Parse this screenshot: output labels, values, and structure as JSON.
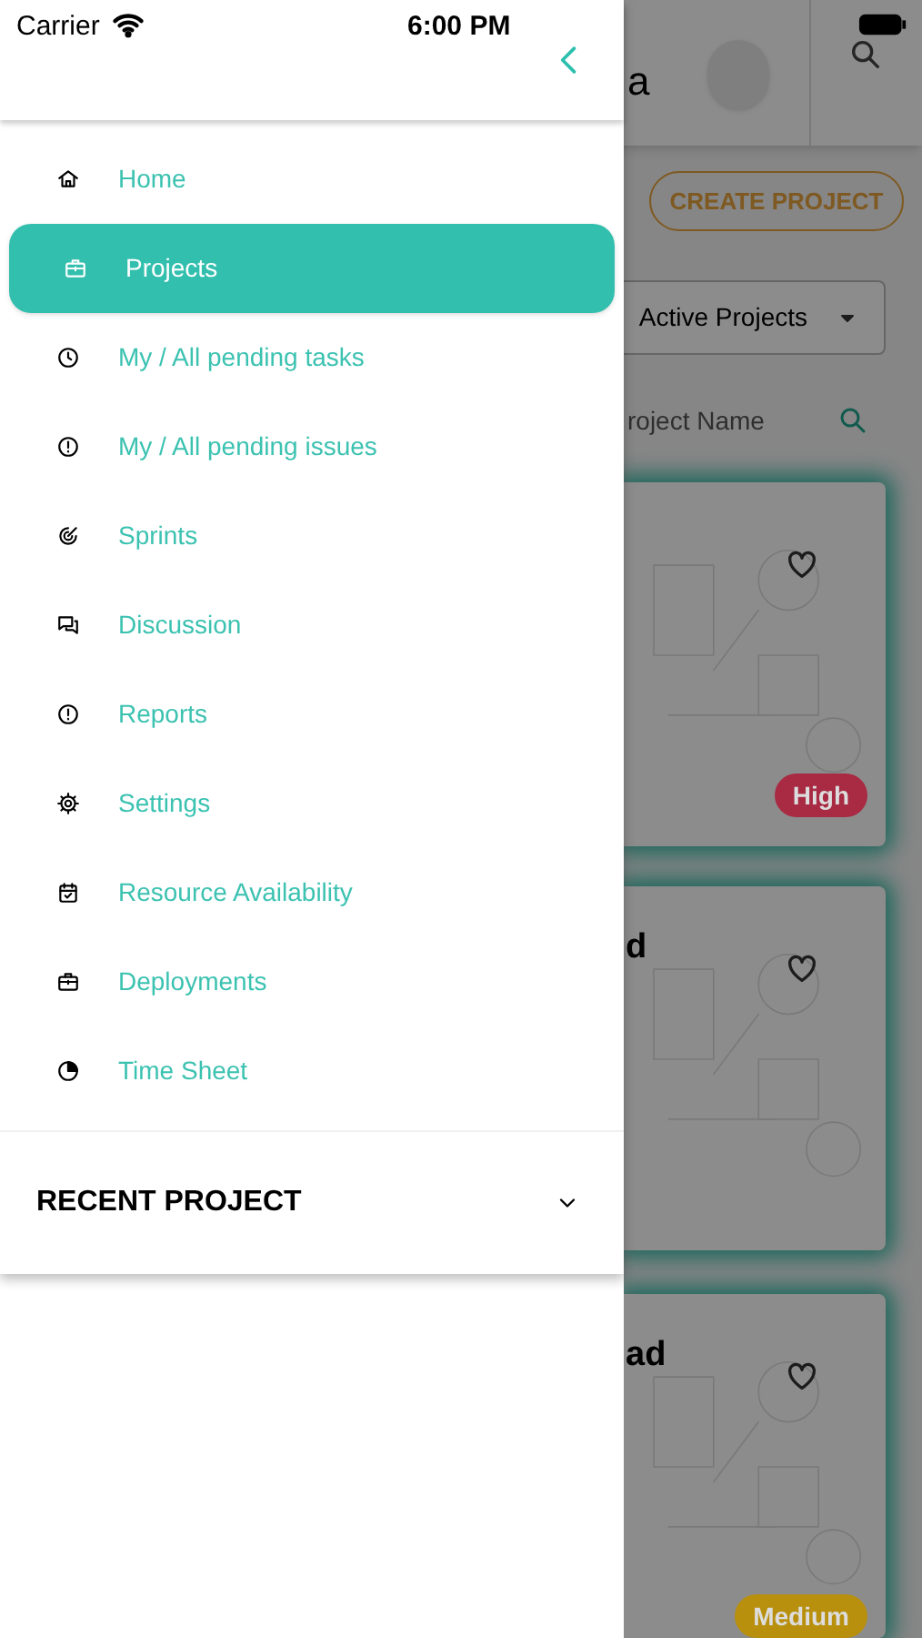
{
  "status_bar": {
    "carrier": "Carrier",
    "time": "6:00 PM"
  },
  "drawer": {
    "items": [
      {
        "label": "Home",
        "kind": "home",
        "selected": false
      },
      {
        "label": "Projects",
        "kind": "briefcase",
        "selected": true
      },
      {
        "label": "My / All pending tasks",
        "kind": "clock",
        "selected": false
      },
      {
        "label": "My / All pending issues",
        "kind": "alert",
        "selected": false
      },
      {
        "label": "Sprints",
        "kind": "target",
        "selected": false
      },
      {
        "label": "Discussion",
        "kind": "chat",
        "selected": false
      },
      {
        "label": "Reports",
        "kind": "alert",
        "selected": false
      },
      {
        "label": "Settings",
        "kind": "gear",
        "selected": false
      },
      {
        "label": "Resource Availability",
        "kind": "calendar",
        "selected": false
      },
      {
        "label": "Deployments",
        "kind": "briefcase",
        "selected": false
      },
      {
        "label": "Time Sheet",
        "kind": "pie",
        "selected": false
      }
    ],
    "recent_project": {
      "title": "RECENT PROJECT",
      "expanded": false
    }
  },
  "background_screen": {
    "title_fragment": "a",
    "create_button": "CREATE PROJECT",
    "filter": {
      "value": "Active Projects"
    },
    "search": {
      "placeholder": "roject Name"
    },
    "cards": [
      {
        "priority": "High",
        "color": "#a82a43"
      },
      {
        "title_fragment": "d"
      },
      {
        "title_fragment": "ad",
        "priority": "Medium",
        "color": "#b8900e"
      }
    ]
  }
}
